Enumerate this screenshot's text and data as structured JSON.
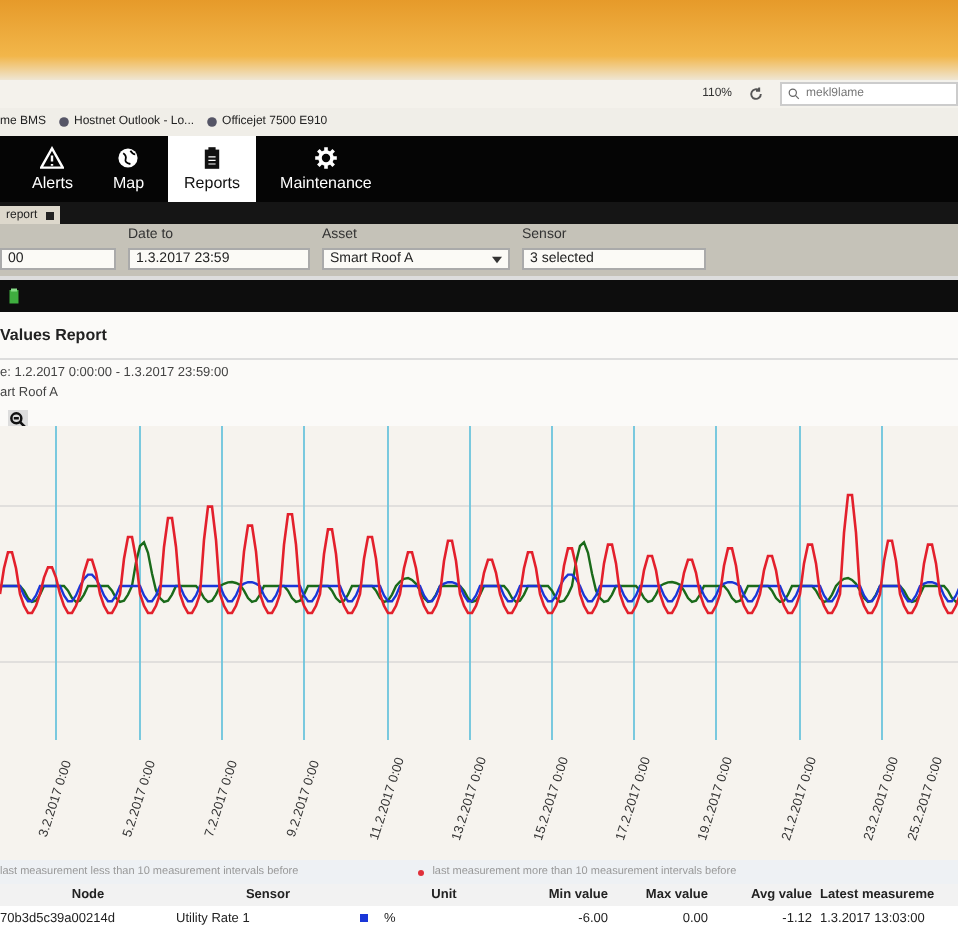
{
  "browser": {
    "zoom": "110%",
    "search": "mekl9lame"
  },
  "bookmarks": [
    {
      "label": "me BMS"
    },
    {
      "label": "Hostnet Outlook - Lo..."
    },
    {
      "label": "Officejet 7500 E910"
    }
  ],
  "nav": [
    {
      "label": "Alerts",
      "selected": false
    },
    {
      "label": "Map",
      "selected": false
    },
    {
      "label": "Reports",
      "selected": true
    },
    {
      "label": "Maintenance",
      "selected": false
    }
  ],
  "tab": {
    "label": "report"
  },
  "filters": [
    {
      "value": "00",
      "kind": "text"
    },
    {
      "label": "Date to",
      "value": "1.3.2017 23:59",
      "kind": "text"
    },
    {
      "label": "Asset",
      "value": "Smart Roof A",
      "kind": "select"
    },
    {
      "label": "Sensor",
      "value": "3 selected",
      "kind": "text"
    }
  ],
  "report": {
    "title": "Values Report",
    "period": "e: 1.2.2017 0:00:00 - 1.3.2017 23:59:00",
    "asset": "art Roof A"
  },
  "chart": {
    "x_labels": [
      "3.2.2017 0:00",
      "5.2.2017 0:00",
      "7.2.2017 0:00",
      "9.2.2017 0:00",
      "11.2.2017 0:00",
      "13.2.2017 0:00",
      "15.2.2017 0:00",
      "17.2.2017 0:00",
      "19.2.2017 0:00",
      "21.2.2017 0:00",
      "23.2.2017 0:00",
      "25.2.2017 0:00"
    ]
  },
  "legend": [
    {
      "label": "last measurement less than 10 measurement intervals before"
    },
    {
      "label": "last measurement more than 10 measurement intervals before",
      "color": "#e0303a"
    }
  ],
  "table": {
    "columns": [
      "Node",
      "Sensor",
      "Unit",
      "Min value",
      "Max value",
      "Avg value",
      "Latest measureme"
    ],
    "rows": [
      {
        "node": "70b3d5c39a00214d",
        "sensor": "Utility Rate 1",
        "color": "#1a36d8",
        "unit": "%",
        "min": "-6.00",
        "max": "0.00",
        "avg": "-1.12",
        "latest": "1.3.2017 13:03:00"
      }
    ]
  }
}
